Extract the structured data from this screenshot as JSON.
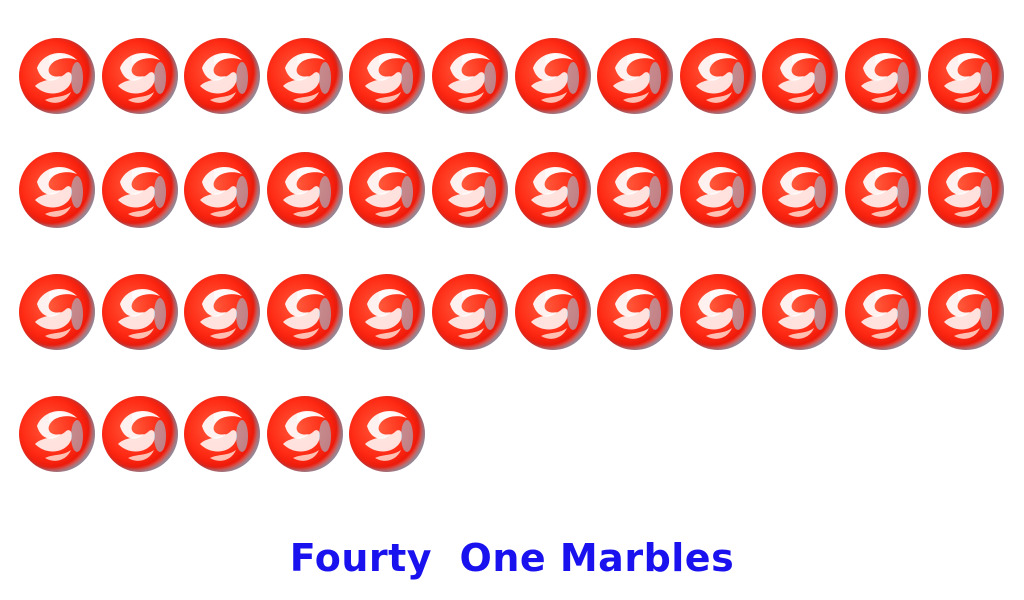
{
  "caption": "Fourty  One Marbles",
  "marble_count": 41,
  "marbles_per_row": 12,
  "colors": {
    "marble_red": "#ff2a14",
    "marble_swirl": "#ffffff",
    "marble_rim": "#5aa6c8",
    "caption": "#1a12ee"
  }
}
